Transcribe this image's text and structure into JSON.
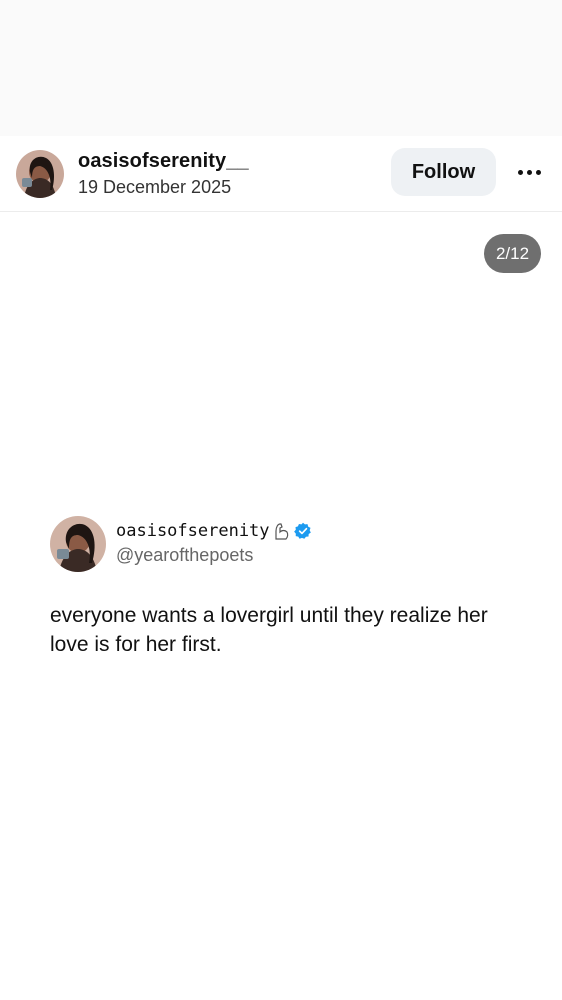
{
  "post": {
    "author": "oasisofserenity__",
    "date": "19 December 2025",
    "follow_label": "Follow",
    "more_icon": "more-horizontal-icon",
    "counter": "2/12"
  },
  "tweet": {
    "display_name": "oasisofserenity",
    "name_icon": "flexed-arm-icon",
    "verified_icon": "verified-badge-icon",
    "verified_color": "#1d9bf0",
    "handle": "@yearofthepoets",
    "text": "everyone wants a lovergirl until they realize her love is for her first."
  },
  "colors": {
    "follow_bg": "#eef1f4",
    "counter_bg": "#6f6f6f"
  }
}
